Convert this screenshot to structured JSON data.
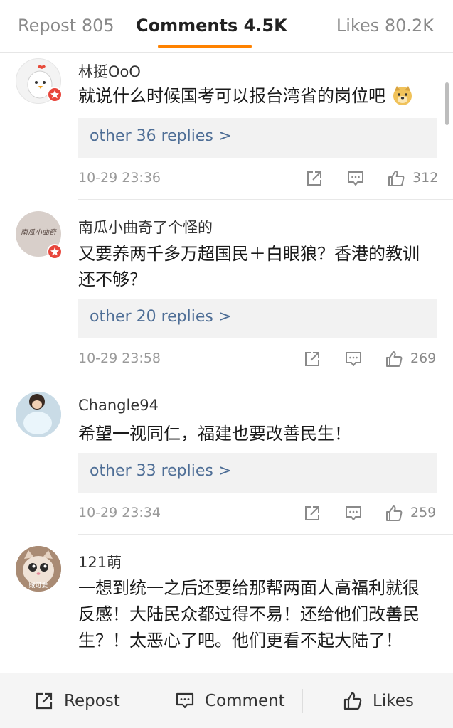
{
  "tabs": {
    "repost": "Repost 805",
    "comments": "Comments 4.5K",
    "likes": "Likes 80.2K"
  },
  "comments": [
    {
      "username": "林挺OoO",
      "text": "就说什么时候国考可以报台湾省的岗位吧",
      "emoji": "doge-emoji",
      "replies": "other 36 replies >",
      "time": "10-29 23:36",
      "likes": "312"
    },
    {
      "username": "南瓜小曲奇了个怪的",
      "text": "又要养两千多万超国民＋白眼狼？香港的教训还不够？",
      "replies": "other 20 replies >",
      "time": "10-29 23:58",
      "likes": "269"
    },
    {
      "username": "Changle94",
      "text": "希望一视同仁，福建也要改善民生！",
      "replies": "other 33 replies >",
      "time": "10-29 23:34",
      "likes": "259"
    },
    {
      "username": "121萌",
      "text": "一想到统一之后还要给那帮两面人高福利就很反感！大陆民众都过得不易！还给他们改善民生？！太恶心了吧。他们更看不起大陆了！"
    }
  ],
  "avatar_text": {
    "c2": "南瓜小曲奇",
    "c4": "賊可愛"
  },
  "bottombar": {
    "repost": "Repost",
    "comment": "Comment",
    "likes": "Likes"
  },
  "colors": {
    "accent": "#ff8200",
    "link": "#4e6e96",
    "badge": "#e8463c"
  }
}
